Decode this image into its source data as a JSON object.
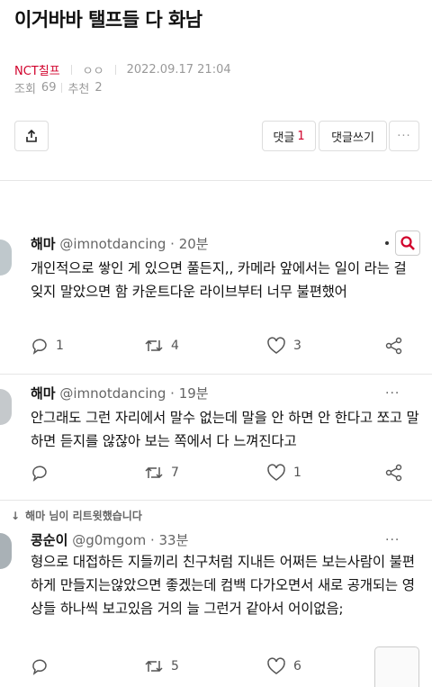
{
  "post": {
    "title": "이거바바 탤프들 다 화남",
    "board": "NCT칠프",
    "author": "ㅇㅇ",
    "datetime": "2022.09.17 21:04",
    "views_label": "조회",
    "views": "69",
    "recommend_label": "추천",
    "recommend": "2"
  },
  "buttons": {
    "comment_label": "댓글",
    "comment_count": "1",
    "write_label": "댓글쓰기",
    "more_label": "···"
  },
  "tweets": [
    {
      "name": "해마",
      "handle": "@imnotdancing · 20분",
      "text": "개인적으로 쌓인 게 있으면 풀든지,, 카메라 앞에서는 일이 라는 걸 잊지 말았으면 함 카운트다운 라이브부터 너무 불편했어",
      "replies": "1",
      "retweets": "4",
      "likes": "3"
    },
    {
      "name": "해마",
      "handle": "@imnotdancing · 19분",
      "text": "안그래도 그런 자리에서 말수 없는데 말을 안 하면 안 한다고 쪼고 말하면 듣지를 않잖아 보는 쪽에서 다 느껴진다고",
      "replies": "",
      "retweets": "7",
      "likes": "1"
    },
    {
      "retweet_note": "해마 님이 리트윗했습니다",
      "name": "콩순이",
      "handle": "@g0mgom · 33분",
      "text": "형으로 대접하든 지들끼리 친구처럼 지내든 어쩌든 보는사람이 불편하게 만들지는않았으면 좋겠는데 컴백 다가오면서 새로 공개되는 영상들 하나씩 보고있음 거의 늘 그런거 같아서 어이없음;",
      "replies": "",
      "retweets": "5",
      "likes": "6"
    }
  ],
  "colors": {
    "accent": "#d1002b",
    "muted": "#999999"
  },
  "icons": [
    "share-icon",
    "search-icon",
    "reply-icon",
    "retweet-icon",
    "like-icon",
    "share-node-icon"
  ]
}
